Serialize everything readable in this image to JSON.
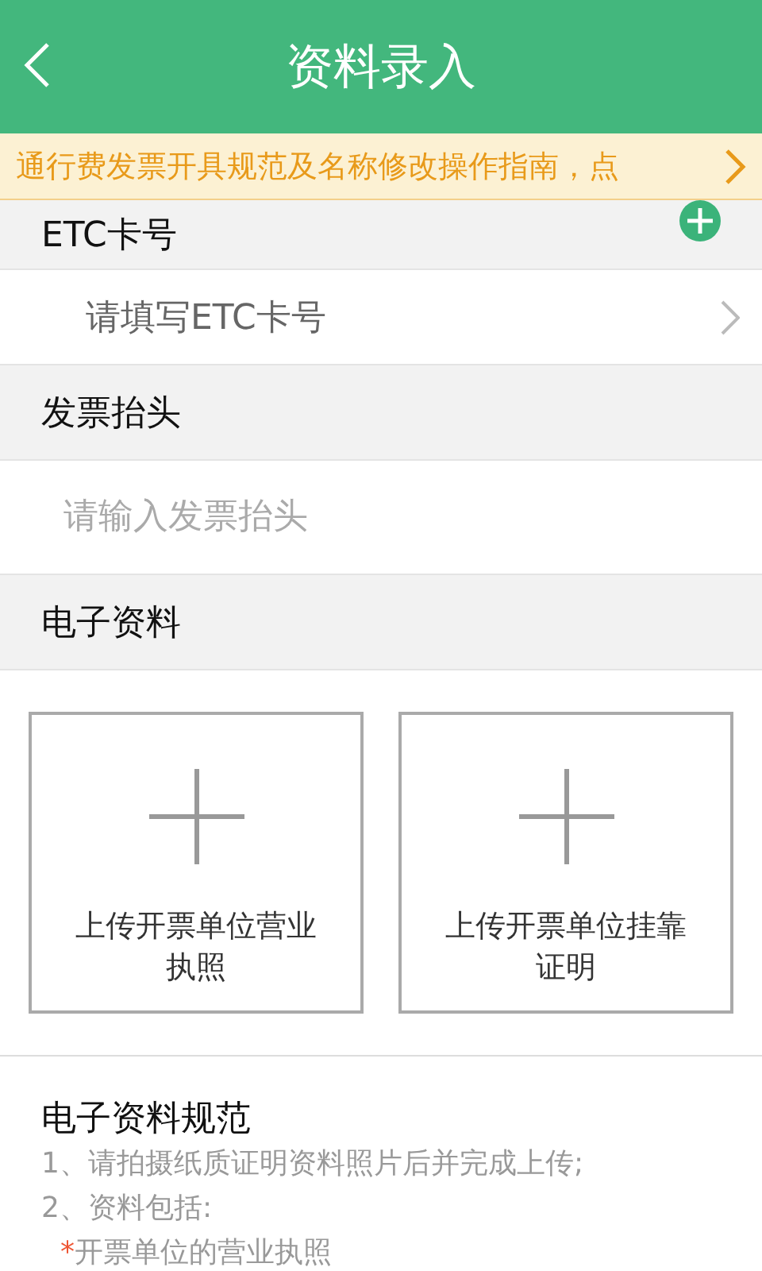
{
  "header": {
    "title": "资料录入"
  },
  "notice": {
    "text": "通行费发票开具规范及名称修改操作指南，点"
  },
  "etc": {
    "label": "ETC卡号",
    "placeholder": "请填写ETC卡号"
  },
  "invoice": {
    "label": "发票抬头",
    "placeholder": "请输入发票抬头"
  },
  "documents": {
    "label": "电子资料",
    "uploads": [
      "上传开票单位营业执照",
      "上传开票单位挂靠证明"
    ]
  },
  "rules": {
    "title": "电子资料规范",
    "lines": [
      {
        "kind": "plain",
        "text": "1、请拍摄纸质证明资料照片后并完成上传;"
      },
      {
        "kind": "plain",
        "text": "2、资料包括:"
      },
      {
        "kind": "required",
        "mark": "*",
        "text": "开票单位的营业执照"
      }
    ]
  }
}
